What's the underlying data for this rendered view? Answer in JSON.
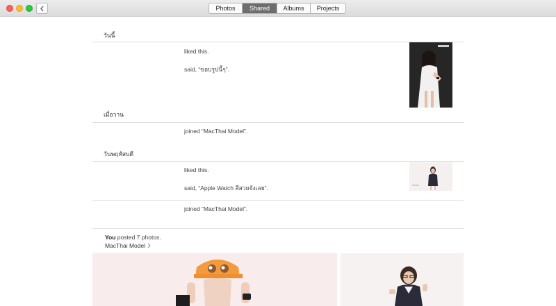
{
  "window": {
    "back_icon": "chevron-left-icon"
  },
  "tabs": [
    {
      "label": "Photos",
      "active": false
    },
    {
      "label": "Shared",
      "active": true
    },
    {
      "label": "Albums",
      "active": false
    },
    {
      "label": "Projects",
      "active": false
    }
  ],
  "activity": {
    "sections": [
      {
        "header": "วันนี้",
        "items": [
          "liked this.",
          "said, “ขอบรูปนี้ๆ”."
        ]
      },
      {
        "header": "เมื่อวาน",
        "items": [
          "joined “MacThai Model”."
        ]
      },
      {
        "header": "วันพฤหัสบดี",
        "items": [
          "liked this.",
          "said, “Apple Watch สีสวยจังเลย”.",
          "joined “MacThai Model”."
        ]
      }
    ]
  },
  "post": {
    "author": "You",
    "text": " posted 7 photos.",
    "album": "MacThai Model",
    "album_icon": "chevron-right-icon"
  },
  "colors": {
    "close": "#fc5f57",
    "minimize": "#fdbc2e",
    "maximize": "#28c840",
    "active_tab": "#6d6d6d"
  }
}
